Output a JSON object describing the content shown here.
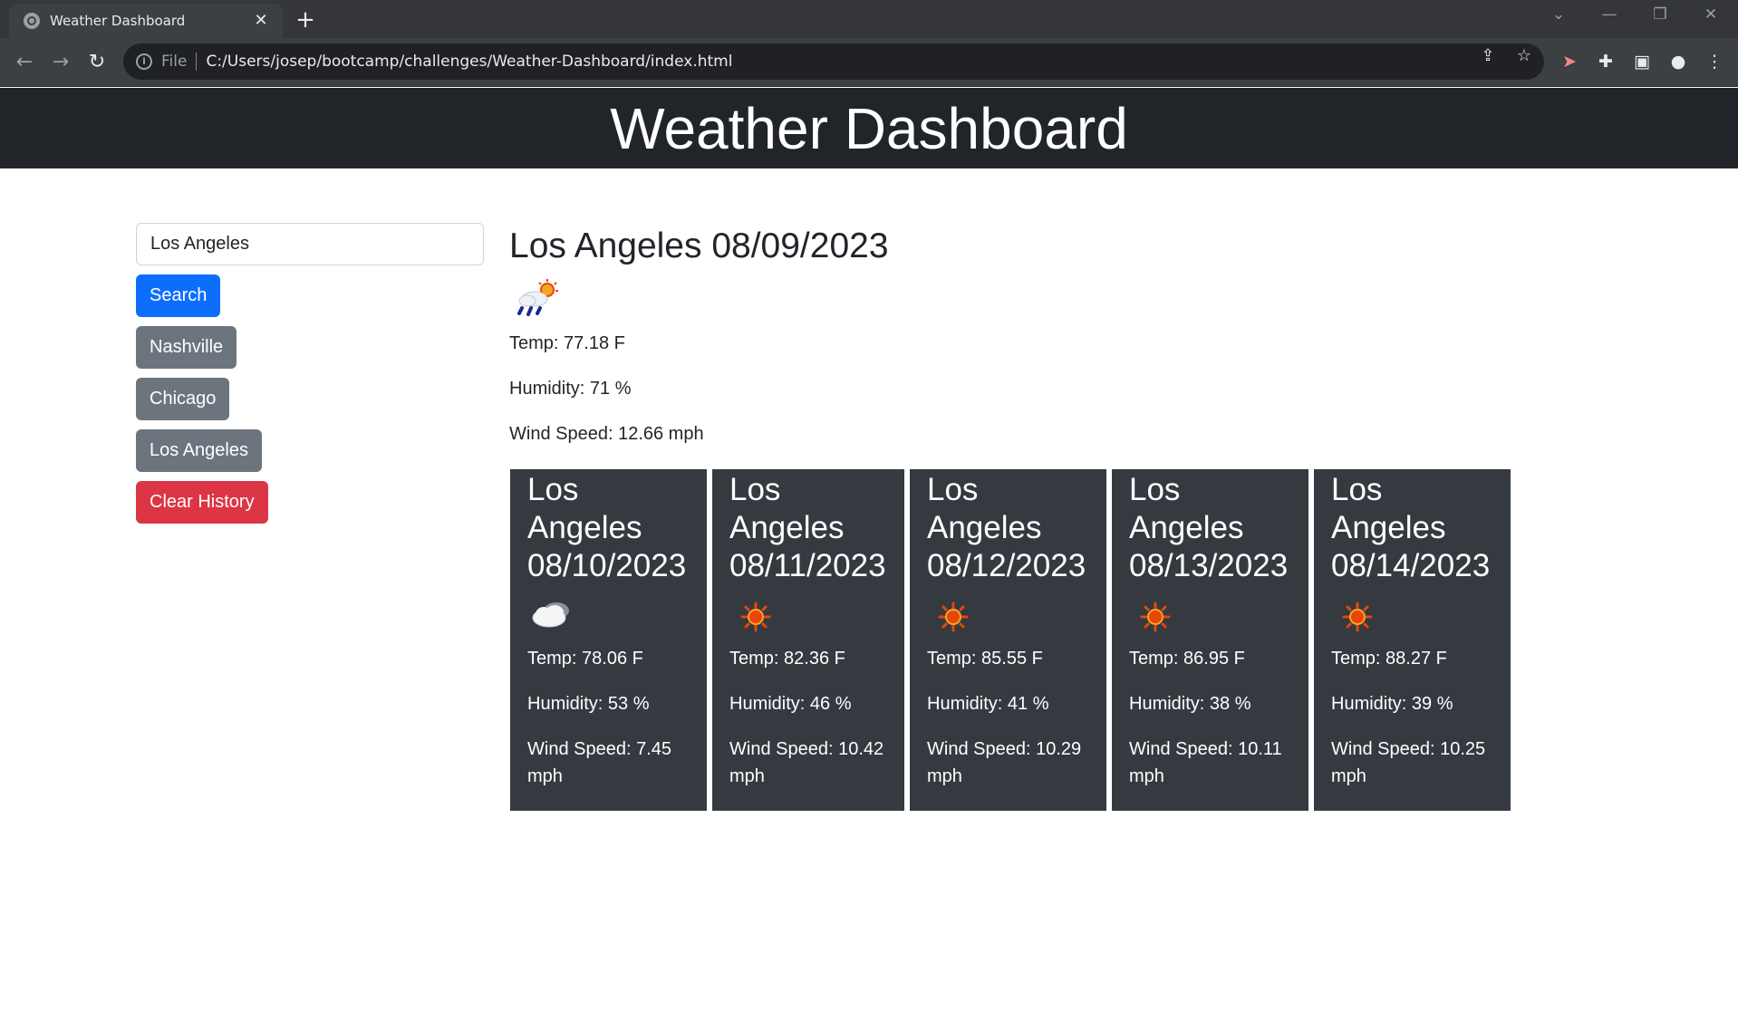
{
  "browser": {
    "tab_title": "Weather Dashboard",
    "url_scheme": "File",
    "url": "C:/Users/josep/bootcamp/challenges/Weather-Dashboard/index.html"
  },
  "header": {
    "title": "Weather Dashboard"
  },
  "sidebar": {
    "search_value": "Los Angeles",
    "search_button": "Search",
    "history": [
      "Nashville",
      "Chicago",
      "Los Angeles"
    ],
    "clear_button": "Clear History"
  },
  "current": {
    "heading": "Los Angeles 08/09/2023",
    "icon": "rain-sun-icon",
    "temp": "Temp: 77.18 F",
    "humidity": "Humidity: 71 %",
    "wind": "Wind Speed: 12.66 mph"
  },
  "forecast": [
    {
      "city": "Los Angeles",
      "date": "08/10/2023",
      "icon": "cloud-icon",
      "temp": "Temp: 78.06 F",
      "humidity": "Humidity: 53 %",
      "wind": "Wind Speed: 7.45 mph"
    },
    {
      "city": "Los Angeles",
      "date": "08/11/2023",
      "icon": "sun-icon",
      "temp": "Temp: 82.36 F",
      "humidity": "Humidity: 46 %",
      "wind": "Wind Speed: 10.42 mph"
    },
    {
      "city": "Los Angeles",
      "date": "08/12/2023",
      "icon": "sun-icon",
      "temp": "Temp: 85.55 F",
      "humidity": "Humidity: 41 %",
      "wind": "Wind Speed: 10.29 mph"
    },
    {
      "city": "Los Angeles",
      "date": "08/13/2023",
      "icon": "sun-icon",
      "temp": "Temp: 86.95 F",
      "humidity": "Humidity: 38 %",
      "wind": "Wind Speed: 10.11 mph"
    },
    {
      "city": "Los Angeles",
      "date": "08/14/2023",
      "icon": "sun-icon",
      "temp": "Temp: 88.27 F",
      "humidity": "Humidity: 39 %",
      "wind": "Wind Speed: 10.25 mph"
    }
  ],
  "colors": {
    "header_bg": "#212529",
    "card_bg": "#343a40",
    "primary": "#0d6efd",
    "secondary": "#6c757d",
    "danger": "#dc3545"
  }
}
